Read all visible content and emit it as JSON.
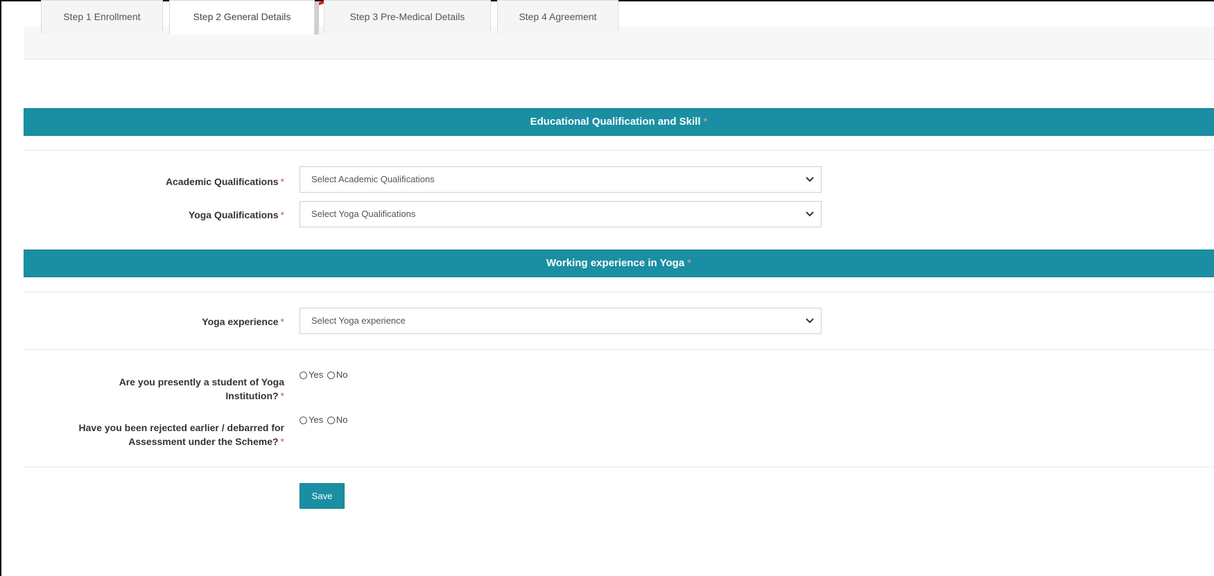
{
  "tabs": [
    {
      "label": "Step 1 Enrollment",
      "active": false
    },
    {
      "label": "Step 2 General Details",
      "active": true
    },
    {
      "label": "Step 3 Pre-Medical Details",
      "active": false
    },
    {
      "label": "Step 4 Agreement",
      "active": false
    }
  ],
  "sections": {
    "education": {
      "title": "Educational Qualification and Skill",
      "required_mark": "*"
    },
    "experience": {
      "title": "Working experience in Yoga",
      "required_mark": "*"
    }
  },
  "fields": {
    "academic": {
      "label": "Academic Qualifications",
      "required_mark": "*",
      "value": "Select Academic Qualifications"
    },
    "yoga_qual": {
      "label": "Yoga Qualifications",
      "required_mark": "*",
      "value": "Select Yoga Qualifications"
    },
    "yoga_exp": {
      "label": "Yoga experience",
      "required_mark": "*",
      "value": "Select Yoga experience"
    }
  },
  "questions": {
    "student": {
      "line1": "Are you presently a student of Yoga",
      "line2": "Institution?",
      "required_mark": "*",
      "yes": "Yes",
      "no": "No"
    },
    "rejected": {
      "line1": "Have you been rejected earlier / debarred for",
      "line2": "Assessment under the Scheme?",
      "required_mark": "*",
      "yes": "Yes",
      "no": "No"
    }
  },
  "save_label": "Save",
  "colors": {
    "section_bar": "#1a8fa3",
    "annotation_arrow": "#e01b1b",
    "required_star": "#d9534f"
  }
}
